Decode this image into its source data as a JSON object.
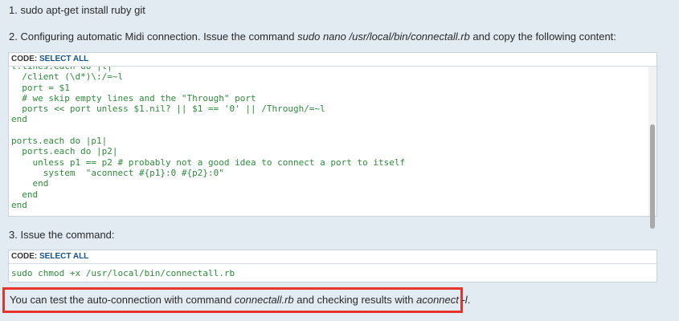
{
  "steps": {
    "step1": "1. sudo apt-get install ruby git",
    "step2": {
      "prefix": "2. Configuring automatic Midi connection. Issue the command ",
      "command": "sudo nano /usr/local/bin/connectall.rb",
      "suffix": " and copy the following content:"
    },
    "step3": "3. Issue the command:"
  },
  "code_block_1": {
    "header_label": "CODE: ",
    "select_all": "SELECT ALL",
    "lines": [
      "t.lines.each do |l|",
      "  /client (\\d*)\\:/=~l",
      "  port = $1",
      "  # we skip empty lines and the \"Through\" port",
      "  ports << port unless $1.nil? || $1 == '0' || /Through/=~l",
      "end",
      "",
      "ports.each do |p1|",
      "  ports.each do |p2|",
      "    unless p1 == p2 # probably not a good idea to connect a port to itself",
      "      system  \"aconnect #{p1}:0 #{p2}:0\"",
      "    end",
      "  end",
      "end"
    ]
  },
  "code_block_2": {
    "header_label": "CODE: ",
    "select_all": "SELECT ALL",
    "line": "sudo chmod +x /usr/local/bin/connectall.rb"
  },
  "note": {
    "prefix": "You can test the auto-connection with command ",
    "command": "connectall.rb",
    "middle": " and checking results with ",
    "check": "aconnect -l",
    "suffix": "."
  },
  "colors": {
    "highlight_border": "#e8332a",
    "code_text": "#2e8b3c",
    "link": "#105289"
  }
}
